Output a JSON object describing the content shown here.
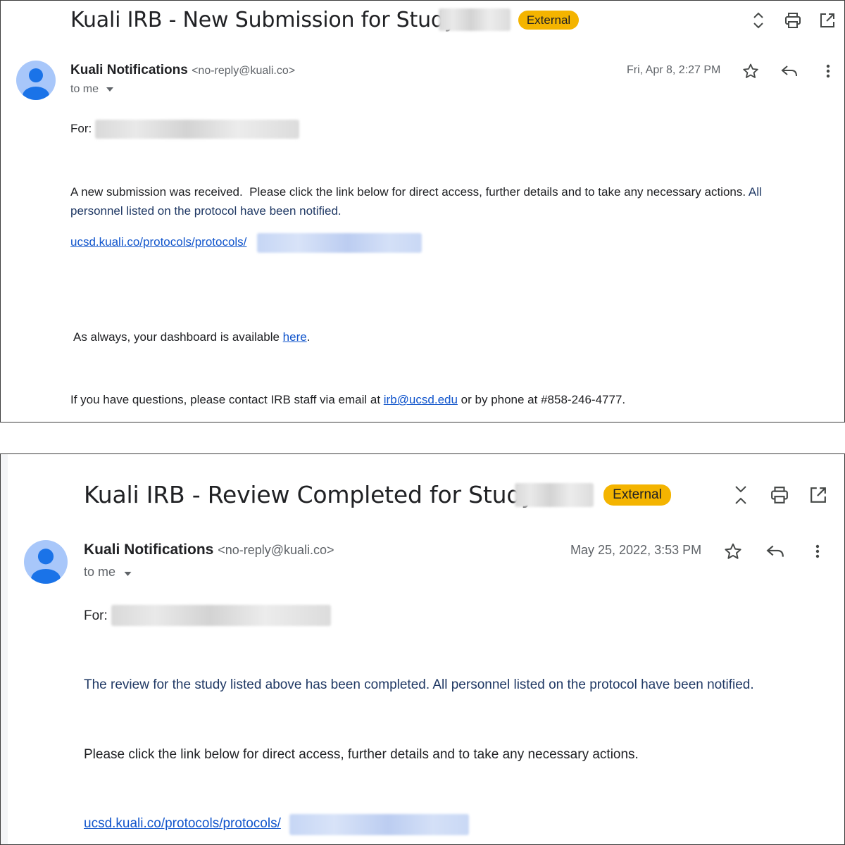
{
  "emails": [
    {
      "subject": "Kuali IRB - New Submission for Study #",
      "badge": "External",
      "sender_name": "Kuali Notifications",
      "sender_email": "<no-reply@kuali.co>",
      "recipient": "to me",
      "date": "Fri, Apr 8, 2:27 PM",
      "for_label": "For:",
      "body_line_1a": "A new submission was received.  Please click the link below for direct access, further details and to take any necessary actions.",
      "body_line_1b": "All",
      "body_line_2": "personnel listed on the protocol have been notified.",
      "link_text": "ucsd.kuali.co/protocols/protocols/",
      "dashboard_prefix": "As always, your dashboard is available",
      "dashboard_link": "here",
      "dashboard_suffix": ".",
      "contact_prefix": "If you have questions, please contact IRB staff via email at",
      "contact_email": "irb@ucsd.edu",
      "contact_suffix": "or by phone at #858-246-4777."
    },
    {
      "subject": "Kuali IRB - Review Completed for Study #",
      "badge": "External",
      "sender_name": "Kuali Notifications",
      "sender_email": "<no-reply@kuali.co>",
      "recipient": "to me",
      "date": "May 25, 2022, 3:53 PM",
      "for_label": "For:",
      "body_line_1": "The review for the study listed above has been completed. All personnel listed on the protocol have been notified.",
      "body_line_2": "Please click the link below for direct access, further details and to take any necessary actions.",
      "link_text": "ucsd.kuali.co/protocols/protocols/"
    }
  ],
  "icons": {
    "expand_toggle_1": "unfold-icon",
    "expand_toggle_2": "collapse-icon",
    "print": "print-icon",
    "open_new_window": "open-in-new-icon",
    "star": "star-icon",
    "reply": "reply-icon",
    "more": "more-vert-icon",
    "recipient_dropdown": "caret-down-icon"
  },
  "colors": {
    "badge": "#f4b400",
    "link": "#1155cc",
    "navy_text": "#1f3864",
    "avatar": "#a8c7fa",
    "avatar_figure": "#1a73e8"
  }
}
